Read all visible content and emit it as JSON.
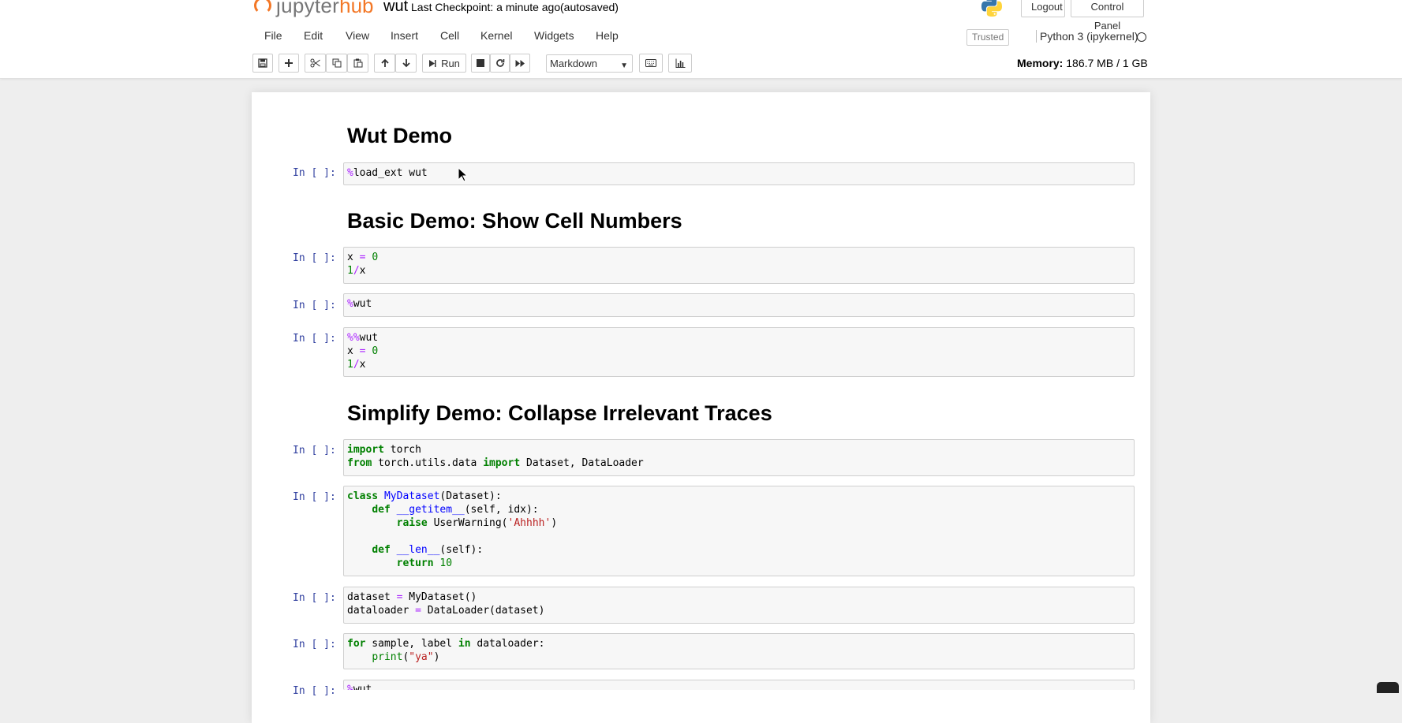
{
  "header": {
    "logo_jupyter": "jupyter",
    "logo_hub": "hub",
    "notebook_name": "wut",
    "checkpoint": "Last Checkpoint: a minute ago",
    "autosave": "(autosaved)",
    "logout_label": "Logout",
    "control_panel_label": "Control Panel"
  },
  "menubar": {
    "items": [
      "File",
      "Edit",
      "View",
      "Insert",
      "Cell",
      "Kernel",
      "Widgets",
      "Help"
    ],
    "trusted": "Trusted",
    "kernel": "Python 3 (ipykernel)"
  },
  "toolbar": {
    "run_label": "Run",
    "cell_type": "Markdown",
    "memory_label": "Memory:",
    "memory_value": "186.7 MB / 1 GB",
    "icons": [
      "save-icon",
      "plus-icon",
      "cut-icon",
      "copy-icon",
      "paste-icon",
      "arrow-up-icon",
      "arrow-down-icon",
      "step-forward-icon",
      "stop-icon",
      "restart-icon",
      "fast-forward-icon",
      "keyboard-icon",
      "bar-chart-icon"
    ]
  },
  "notebook": {
    "prompt": "In [ ]:",
    "headings": [
      "Wut Demo",
      "Basic Demo: Show Cell Numbers",
      "Simplify Demo: Collapse Irrelevant Traces"
    ],
    "cells": [
      [
        "%load_ext wut"
      ],
      [
        "x = 0",
        "1/x"
      ],
      [
        "%wut"
      ],
      [
        "%%wut",
        "x = 0",
        "1/x"
      ],
      [
        "import torch",
        "from torch.utils.data import Dataset, DataLoader"
      ],
      [
        "class MyDataset(Dataset):",
        "    def __getitem__(self, idx):",
        "        raise UserWarning('Ahhhh')",
        "",
        "    def __len__(self):",
        "        return 10"
      ],
      [
        "dataset = MyDataset()",
        "dataloader = DataLoader(dataset)"
      ],
      [
        "for sample, label in dataloader:",
        "    print(\"ya\")"
      ],
      [
        "%wut"
      ]
    ]
  },
  "colors": {
    "accent": "#f37726",
    "prompt": "#303f9f",
    "keyword": "#008000",
    "operator": "#aa22ff",
    "string": "#ba2121",
    "function": "#0000ff"
  }
}
